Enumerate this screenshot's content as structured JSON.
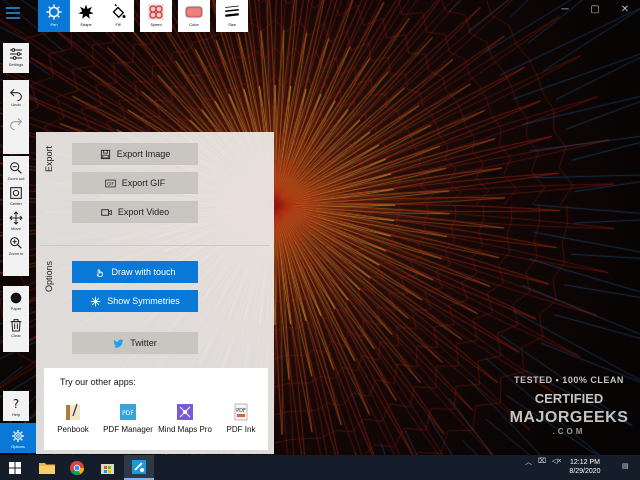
{
  "toolbar": {
    "tools": [
      {
        "label": "Pen",
        "active": true,
        "icon": "gear-brush-icon"
      },
      {
        "label": "Shape",
        "active": false,
        "icon": "star-shape-icon"
      },
      {
        "label": "Fill",
        "active": false,
        "icon": "paint-bucket-icon"
      },
      {
        "label": "Symm",
        "active": false,
        "icon": "symmetry-icon"
      },
      {
        "label": "Color",
        "active": false,
        "icon": "color-swatch-icon"
      },
      {
        "label": "Size",
        "active": false,
        "icon": "line-size-icon"
      }
    ]
  },
  "sidebar": {
    "items": [
      {
        "label": "Settings",
        "icon": "sliders-icon"
      },
      {
        "label": "Undo",
        "icon": "undo-icon"
      },
      {
        "label": "",
        "icon": "redo-icon"
      },
      {
        "label": "Zoom out",
        "icon": "zoom-out-icon"
      },
      {
        "label": "Center",
        "icon": "center-icon"
      },
      {
        "label": "Move",
        "icon": "move-icon"
      },
      {
        "label": "Zoom in",
        "icon": "zoom-in-icon"
      },
      {
        "label": "Paper",
        "icon": "paper-circle-icon"
      },
      {
        "label": "Clear",
        "icon": "trash-icon"
      },
      {
        "label": "Help",
        "icon": "help-icon"
      },
      {
        "label": "Options",
        "icon": "gear-icon"
      }
    ]
  },
  "panel": {
    "export_title": "Export",
    "export_buttons": [
      "Export Image",
      "Export GIF",
      "Export Video"
    ],
    "options_title": "Options",
    "draw_with_touch": "Draw with touch",
    "show_symmetries": "Show Symmetries",
    "twitter": "Twitter",
    "apps_title": "Try our other apps:",
    "apps": [
      "Penbook",
      "PDF Manager",
      "Mind Maps Pro",
      "PDF Ink"
    ]
  },
  "watermark": {
    "line1": "TESTED • 100% CLEAN",
    "line2": "CERTIFIED",
    "line3": "MAJORGEEKS",
    "line4": ".COM"
  },
  "taskbar": {
    "time": "12:12 PM",
    "date": "8/29/2020"
  },
  "colors": {
    "accent": "#0a78d7",
    "panel_bg": "#eeece9",
    "taskbar": "#151d2a"
  }
}
